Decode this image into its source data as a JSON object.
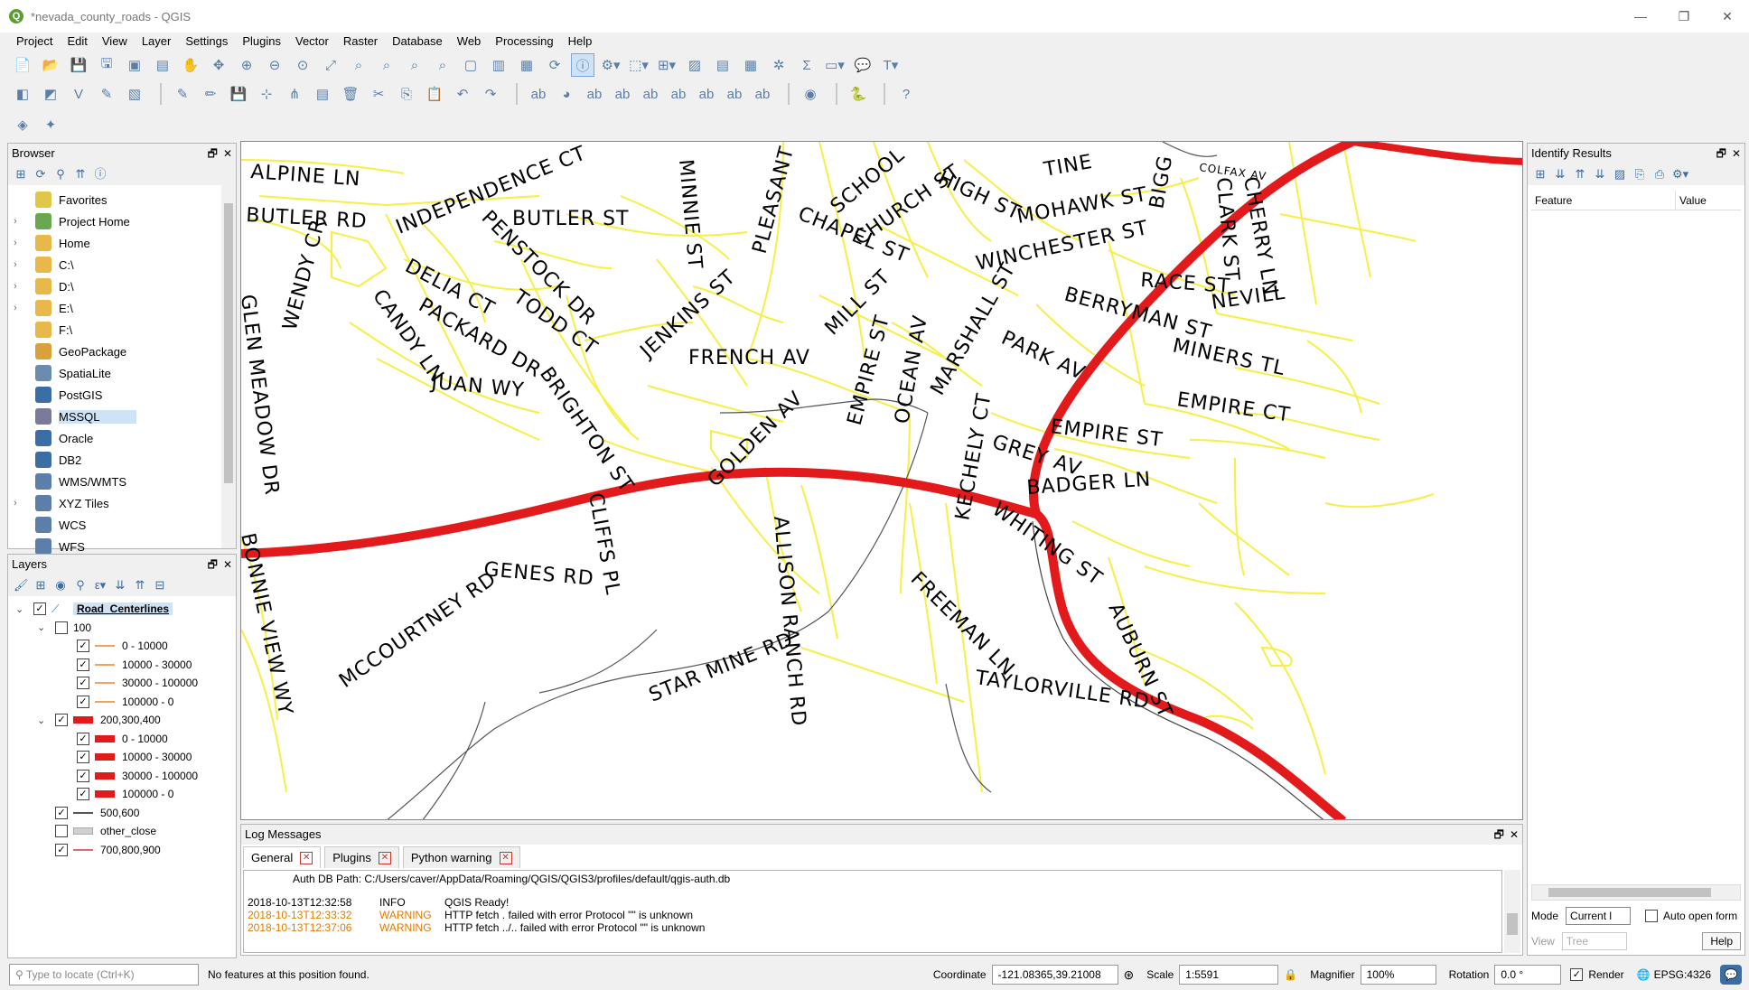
{
  "window": {
    "title": "*nevada_county_roads - QGIS",
    "app_icon": "Q"
  },
  "menu": [
    "Project",
    "Edit",
    "View",
    "Layer",
    "Settings",
    "Plugins",
    "Vector",
    "Raster",
    "Database",
    "Web",
    "Processing",
    "Help"
  ],
  "browser": {
    "title": "Browser",
    "items": [
      {
        "label": "Favorites",
        "icon": "star-icon",
        "color": "#e0c74a",
        "arrow": ""
      },
      {
        "label": "Project Home",
        "icon": "project-home-icon",
        "color": "#6aa84f",
        "arrow": "›"
      },
      {
        "label": "Home",
        "icon": "folder-icon",
        "color": "#e8b94a",
        "arrow": "›"
      },
      {
        "label": "C:\\",
        "icon": "folder-icon",
        "color": "#e8b94a",
        "arrow": "›"
      },
      {
        "label": "D:\\",
        "icon": "folder-icon",
        "color": "#e8b94a",
        "arrow": "›"
      },
      {
        "label": "E:\\",
        "icon": "folder-icon",
        "color": "#e8b94a",
        "arrow": "›"
      },
      {
        "label": "F:\\",
        "icon": "folder-icon",
        "color": "#e8b94a",
        "arrow": ""
      },
      {
        "label": "GeoPackage",
        "icon": "geopackage-icon",
        "color": "#d9a13b",
        "arrow": ""
      },
      {
        "label": "SpatiaLite",
        "icon": "spatialite-icon",
        "color": "#6b8cae",
        "arrow": ""
      },
      {
        "label": "PostGIS",
        "icon": "postgis-icon",
        "color": "#3b6ea5",
        "arrow": ""
      },
      {
        "label": "MSSQL",
        "icon": "mssql-icon",
        "color": "#7a7a9a",
        "arrow": ""
      },
      {
        "label": "Oracle",
        "icon": "oracle-icon",
        "color": "#3b6ea5",
        "arrow": ""
      },
      {
        "label": "DB2",
        "icon": "db2-icon",
        "color": "#3b6ea5",
        "arrow": ""
      },
      {
        "label": "WMS/WMTS",
        "icon": "globe-icon",
        "color": "#5b7fa8",
        "arrow": ""
      },
      {
        "label": "XYZ Tiles",
        "icon": "globe-icon",
        "color": "#5b7fa8",
        "arrow": "›"
      },
      {
        "label": "WCS",
        "icon": "globe-icon",
        "color": "#5b7fa8",
        "arrow": ""
      },
      {
        "label": "WFS",
        "icon": "globe-icon",
        "color": "#5b7fa8",
        "arrow": ""
      }
    ]
  },
  "layers": {
    "title": "Layers",
    "rows": [
      {
        "label": "Road_Centerlines",
        "indent": 0,
        "checked": true,
        "expand": "⌄",
        "sym": "line-icon",
        "top": true
      },
      {
        "label": "100",
        "indent": 1,
        "checked": false,
        "expand": "⌄",
        "sym": ""
      },
      {
        "label": "0 - 10000",
        "indent": 2,
        "checked": true,
        "expand": "",
        "sym": "thin-orange"
      },
      {
        "label": "10000 - 30000",
        "indent": 2,
        "checked": true,
        "expand": "",
        "sym": "thin-orange"
      },
      {
        "label": "30000 - 100000",
        "indent": 2,
        "checked": true,
        "expand": "",
        "sym": "thin-orange"
      },
      {
        "label": "100000 - 0",
        "indent": 2,
        "checked": true,
        "expand": "",
        "sym": "thin-orange"
      },
      {
        "label": "200,300,400",
        "indent": 1,
        "checked": true,
        "expand": "⌄",
        "sym": "thick-red"
      },
      {
        "label": "0 - 10000",
        "indent": 2,
        "checked": true,
        "expand": "",
        "sym": "thick-red"
      },
      {
        "label": "10000 - 30000",
        "indent": 2,
        "checked": true,
        "expand": "",
        "sym": "thick-red"
      },
      {
        "label": "30000 - 100000",
        "indent": 2,
        "checked": true,
        "expand": "",
        "sym": "thick-red"
      },
      {
        "label": "100000 - 0",
        "indent": 2,
        "checked": true,
        "expand": "",
        "sym": "thick-red"
      },
      {
        "label": "500,600",
        "indent": 1,
        "checked": true,
        "expand": "",
        "sym": "thin-dark"
      },
      {
        "label": "other_close",
        "indent": 1,
        "checked": false,
        "expand": "",
        "sym": "grey-band"
      },
      {
        "label": "700,800,900",
        "indent": 1,
        "checked": true,
        "expand": "",
        "sym": "thin-red"
      }
    ]
  },
  "map": {
    "labels": [
      "ALPINE LN",
      "BUTLER RD",
      "INDEPENDENCE CT",
      "BUTLER ST",
      "MINNIE ST",
      "PLEASANT",
      "SCHOOL",
      "CHURCH ST",
      "HIGH ST",
      "TINE",
      "COLFAX AV",
      "BIGG",
      "CLARK ST",
      "CHERRY LN",
      "MOHAWK ST",
      "CHAPEL ST",
      "WINCHESTER ST",
      "RACE ST",
      "NEVILL",
      "BERRYMAN ST",
      "WENDY CR",
      "PENSTOCK DR",
      "DELIA CT",
      "TODD CT",
      "JENKINS ST",
      "MILL ST",
      "CANDY LN",
      "PACKARD DR",
      "FRENCH AV",
      "EMPIRE ST",
      "OCEAN AV",
      "MARSHALL ST",
      "PARK AV",
      "MINERS TL",
      "GLEN MEADOW DR",
      "JUAN WY",
      "BRIGHTON ST",
      "EMPIRE CT",
      "GOLDEN AV",
      "EMPIRE ST",
      "GREY AV",
      "KECHELY CT",
      "BADGER LN",
      "CLIFFS PL",
      "WHITING ST",
      "BONNIE VIEW WY",
      "GENES RD",
      "ALLISON RANCH RD",
      "FREEMAN LN",
      "MCCOURTNEY RD",
      "STAR MINE RD",
      "AUBURN ST",
      "TAYLORVILLE RD"
    ]
  },
  "log": {
    "title": "Log Messages",
    "tabs": [
      "General",
      "Plugins",
      "Python warning"
    ],
    "lines": [
      {
        "ts": "",
        "lvl": "",
        "msg": "Auth DB Path: C:/Users/caver/AppData/Roaming/QGIS/QGIS3/profiles/default/qgis-auth.db",
        "warn": false
      },
      {
        "ts": "2018-10-13T12:32:58",
        "lvl": "INFO",
        "msg": "QGIS Ready!",
        "warn": false
      },
      {
        "ts": "2018-10-13T12:33:32",
        "lvl": "WARNING",
        "msg": "HTTP fetch . failed with error Protocol \"\" is unknown",
        "warn": true
      },
      {
        "ts": "2018-10-13T12:37:06",
        "lvl": "WARNING",
        "msg": "HTTP fetch ../.. failed with error Protocol \"\" is unknown",
        "warn": true
      }
    ]
  },
  "identify": {
    "title": "Identify Results",
    "col_feature": "Feature",
    "col_value": "Value",
    "mode_label": "Mode",
    "mode_value": "Current l",
    "auto_open": "Auto open form",
    "view_label": "View",
    "view_value": "Tree",
    "help": "Help"
  },
  "status": {
    "locator_placeholder": "Type to locate (Ctrl+K)",
    "message": "No features at this position found.",
    "coordinate_label": "Coordinate",
    "coordinate": "-121.08365,39.21008",
    "scale_label": "Scale",
    "scale": "1:5591",
    "magnifier_label": "Magnifier",
    "magnifier": "100%",
    "rotation_label": "Rotation",
    "rotation": "0.0 °",
    "render_label": "Render",
    "crs": "EPSG:4326"
  }
}
